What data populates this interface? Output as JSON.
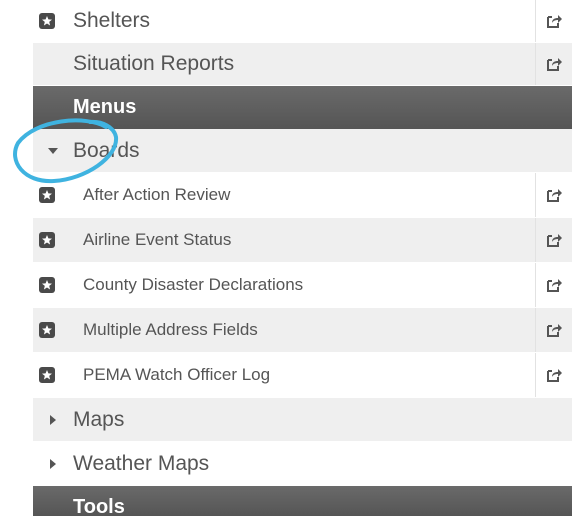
{
  "sidebar": {
    "top_items": [
      {
        "label": "Shelters",
        "icon": "star-box-icon",
        "share_icon": "share-icon"
      },
      {
        "label": "Situation Reports",
        "share_icon": "share-icon"
      }
    ],
    "menus_header": "Menus",
    "folders": {
      "boards": {
        "label": "Boards",
        "state": "expanded"
      },
      "maps": {
        "label": "Maps",
        "state": "collapsed"
      },
      "weather_maps": {
        "label": "Weather Maps",
        "state": "collapsed"
      }
    },
    "board_items": [
      {
        "label": "After Action Review"
      },
      {
        "label": "Airline Event Status"
      },
      {
        "label": "County Disaster Declarations"
      },
      {
        "label": "Multiple Address Fields"
      },
      {
        "label": "PEMA Watch Officer Log"
      }
    ],
    "tools_header": "Tools"
  },
  "colors": {
    "header_bg": "#5e5e5e",
    "row_alt": "#efefef",
    "text": "#555555",
    "annotation_circle": "#3fb3e0"
  }
}
